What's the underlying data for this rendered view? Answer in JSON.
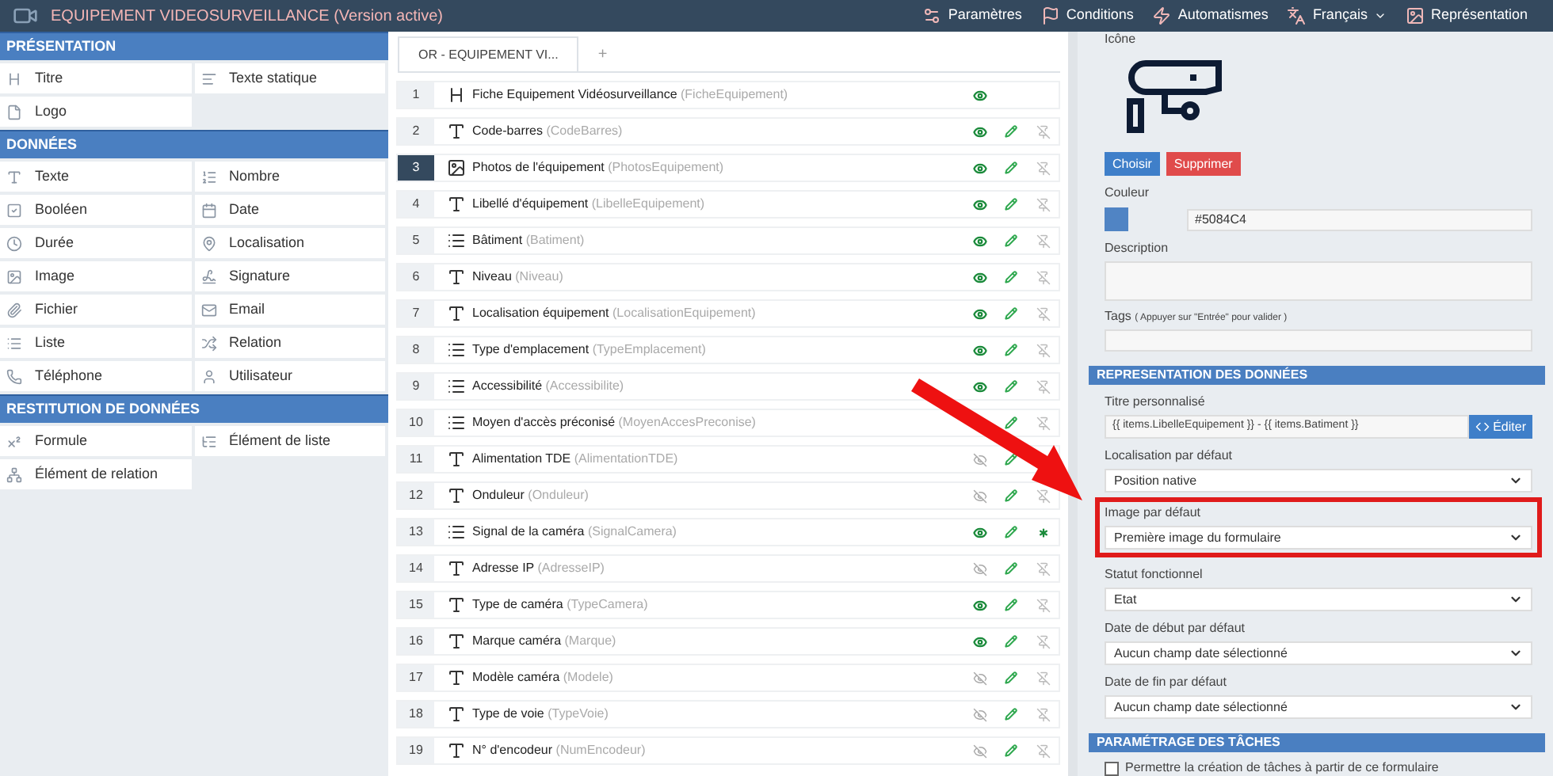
{
  "topbar": {
    "title": "EQUIPEMENT VIDEOSURVEILLANCE (Version active)",
    "menu": [
      {
        "label": "Paramètres",
        "dropdown": false
      },
      {
        "label": "Conditions",
        "dropdown": false
      },
      {
        "label": "Automatismes",
        "dropdown": false
      },
      {
        "label": "Français",
        "dropdown": true
      },
      {
        "label": "Représentation",
        "dropdown": false
      }
    ]
  },
  "palette": [
    {
      "title": "PRÉSENTATION",
      "items": [
        "Titre",
        "Texte statique",
        "Logo"
      ]
    },
    {
      "title": "DONNÉES",
      "items": [
        "Texte",
        "Nombre",
        "Booléen",
        "Date",
        "Durée",
        "Localisation",
        "Image",
        "Signature",
        "Fichier",
        "Email",
        "Liste",
        "Relation",
        "Téléphone",
        "Utilisateur"
      ]
    },
    {
      "title": "RESTITUTION DE DONNÉES",
      "items": [
        "Formule",
        "Élément de liste",
        "Élément de relation"
      ]
    }
  ],
  "form_tabs": [
    {
      "label": "OR - EQUIPEMENT VI...",
      "selected": true
    },
    {
      "label": "+",
      "selected": false
    }
  ],
  "fields": [
    {
      "number": "1",
      "kind": "heading",
      "label": "Fiche Equipement Vidéosurveillance",
      "code": "(FicheEquipement)",
      "selected": false,
      "visible": true
    },
    {
      "number": "2",
      "kind": "text",
      "label": "Code-barres",
      "code": "(CodeBarres)",
      "selected": false,
      "visible": true,
      "editable": true,
      "required": false
    },
    {
      "number": "3",
      "kind": "image",
      "label": "Photos de l'équipement",
      "code": "(PhotosEquipement)",
      "selected": true,
      "visible": true,
      "editable": true,
      "required": false
    },
    {
      "number": "4",
      "kind": "text",
      "label": "Libellé d'équipement",
      "code": "(LibelleEquipement)",
      "selected": false,
      "visible": true,
      "editable": true,
      "required": false
    },
    {
      "number": "5",
      "kind": "list",
      "label": "Bâtiment",
      "code": "(Batiment)",
      "selected": false,
      "visible": true,
      "editable": true,
      "required": false
    },
    {
      "number": "6",
      "kind": "text",
      "label": "Niveau",
      "code": "(Niveau)",
      "selected": false,
      "visible": true,
      "editable": true,
      "required": false
    },
    {
      "number": "7",
      "kind": "text",
      "label": "Localisation équipement",
      "code": "(LocalisationEquipement)",
      "selected": false,
      "visible": true,
      "editable": true,
      "required": false
    },
    {
      "number": "8",
      "kind": "list",
      "label": "Type d'emplacement",
      "code": "(TypeEmplacement)",
      "selected": false,
      "visible": true,
      "editable": true,
      "required": false
    },
    {
      "number": "9",
      "kind": "list",
      "label": "Accessibilité",
      "code": "(Accessibilite)",
      "selected": false,
      "visible": true,
      "editable": true,
      "required": false
    },
    {
      "number": "10",
      "kind": "list",
      "label": "Moyen d'accès préconisé",
      "code": "(MoyenAccesPreconise)",
      "selected": false,
      "editable": true,
      "required": false
    },
    {
      "number": "11",
      "kind": "text",
      "label": "Alimentation TDE",
      "code": "(AlimentationTDE)",
      "selected": false,
      "visible": false,
      "editable": true
    },
    {
      "number": "12",
      "kind": "text",
      "label": "Onduleur",
      "code": "(Onduleur)",
      "selected": false,
      "visible": false,
      "editable": true,
      "required": false
    },
    {
      "number": "13",
      "kind": "list",
      "label": "Signal de la caméra",
      "code": "(SignalCamera)",
      "selected": false,
      "visible": true,
      "editable": true,
      "required": true
    },
    {
      "number": "14",
      "kind": "text",
      "label": "Adresse IP",
      "code": "(AdresseIP)",
      "selected": false,
      "visible": false,
      "editable": true,
      "required": false
    },
    {
      "number": "15",
      "kind": "text",
      "label": "Type de caméra",
      "code": "(TypeCamera)",
      "selected": false,
      "visible": true,
      "editable": true,
      "required": false
    },
    {
      "number": "16",
      "kind": "text",
      "label": "Marque caméra",
      "code": "(Marque)",
      "selected": false,
      "visible": true,
      "editable": true,
      "required": false
    },
    {
      "number": "17",
      "kind": "text",
      "label": "Modèle caméra",
      "code": "(Modele)",
      "selected": false,
      "visible": false,
      "editable": true,
      "required": false
    },
    {
      "number": "18",
      "kind": "text",
      "label": "Type de voie",
      "code": "(TypeVoie)",
      "selected": false,
      "visible": false,
      "editable": true,
      "required": false
    },
    {
      "number": "19",
      "kind": "text",
      "label": "N° d'encodeur",
      "code": "(NumEncodeur)",
      "selected": false,
      "visible": false,
      "editable": true,
      "required": false
    }
  ],
  "properties": {
    "icon_label": "Icône",
    "choose_button": "Choisir",
    "delete_button": "Supprimer",
    "color_label": "Couleur",
    "color": "#5084c4",
    "color_value": "#5084C4",
    "description_label": "Description",
    "tags_label": "Tags",
    "tags_hint": "( Appuyer sur \"Entrée\" pour valider )"
  },
  "representation": {
    "title": "REPRESENTATION DES DONNÉES",
    "custom_title_label": "Titre personnalisé",
    "custom_title_value": "{{ items.LibelleEquipement }} - {{ items.Batiment }}",
    "edit_button": "Éditer",
    "selects": [
      {
        "label": "Localisation par défaut",
        "value": "Position native",
        "highlighted": false
      },
      {
        "label": "Image par défaut",
        "value": "Première image du formulaire",
        "highlighted": true
      },
      {
        "label": "Statut fonctionnel",
        "value": "Etat",
        "highlighted": false
      },
      {
        "label": "Date de début par défaut",
        "value": "Aucun champ date sélectionné",
        "highlighted": false
      },
      {
        "label": "Date de fin par défaut",
        "value": "Aucun champ date sélectionné",
        "highlighted": false
      }
    ]
  },
  "tasks": {
    "title": "PARAMÉTRAGE DES TÂCHES",
    "option": {
      "label": "Permettre la création de tâches à partir de ce formulaire",
      "checked": false
    }
  }
}
